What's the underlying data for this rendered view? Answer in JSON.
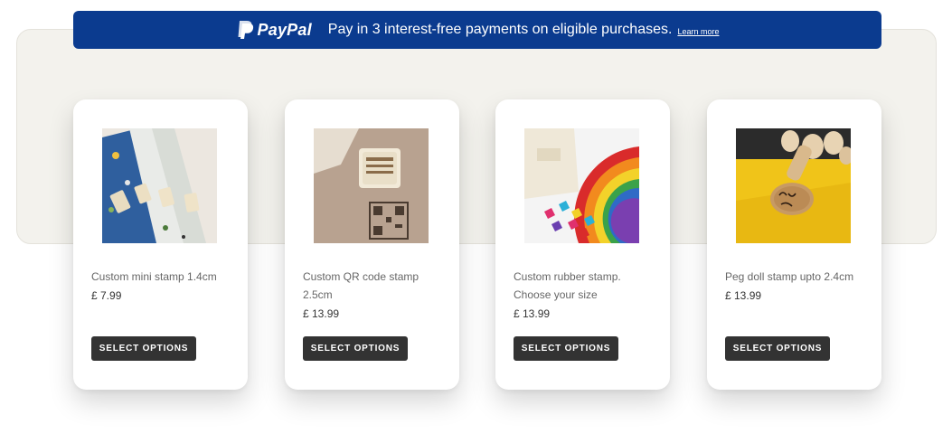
{
  "paypal_banner": {
    "brand": "PayPal",
    "message": "Pay in 3 interest-free payments on eligible purchases.",
    "learn_more": "Learn more",
    "background_color": "#0b3b8f"
  },
  "products": [
    {
      "title": "Custom mini stamp 1.4cm",
      "price": "£ 7.99",
      "button": "SELECT OPTIONS",
      "image": "fabric-stamps-photo"
    },
    {
      "title": "Custom QR code stamp 2.5cm",
      "price": "£ 13.99",
      "button": "SELECT OPTIONS",
      "image": "qr-stamp-photo"
    },
    {
      "title": "Custom rubber stamp. Choose your size",
      "price": "£ 13.99",
      "button": "SELECT OPTIONS",
      "image": "rainbow-stamp-photo"
    },
    {
      "title": "Peg doll stamp upto 2.4cm",
      "price": "£ 13.99",
      "button": "SELECT OPTIONS",
      "image": "peg-doll-stamp-photo"
    }
  ],
  "colors": {
    "button": "#333333",
    "panel": "#f3f2ed"
  }
}
